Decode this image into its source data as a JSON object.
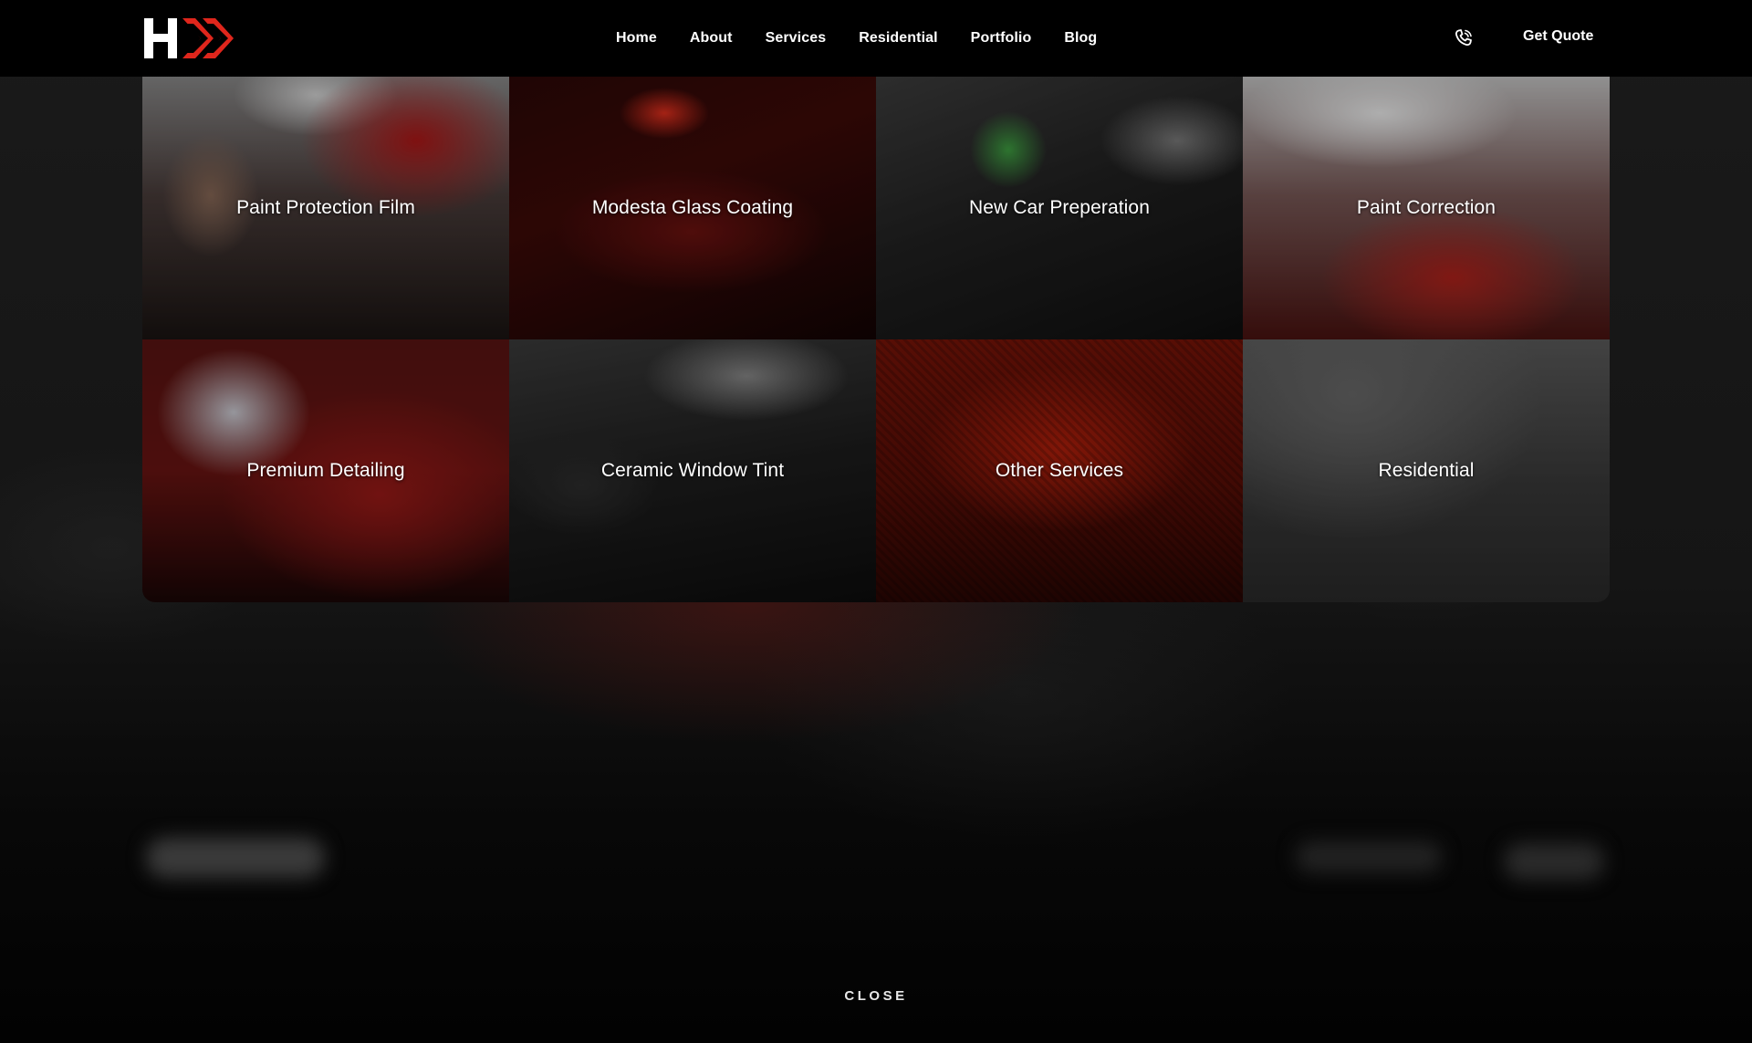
{
  "header": {
    "logo_alt": "H",
    "nav": [
      "Home",
      "About",
      "Services",
      "Residential",
      "Portfolio",
      "Blog"
    ],
    "cta_label": "Get Quote",
    "phone_icon": "phone-icon",
    "brand_colors": {
      "logo_white": "#ffffff",
      "logo_red": "#e0261c"
    }
  },
  "services": [
    {
      "label": "Paint Protection Film"
    },
    {
      "label": "Modesta Glass Coating"
    },
    {
      "label": "New Car Preperation"
    },
    {
      "label": "Paint Correction"
    },
    {
      "label": "Premium Detailing"
    },
    {
      "label": "Ceramic Window Tint"
    },
    {
      "label": "Other Services"
    },
    {
      "label": "Residential"
    }
  ],
  "overlay": {
    "close_label": "CLOSE"
  }
}
